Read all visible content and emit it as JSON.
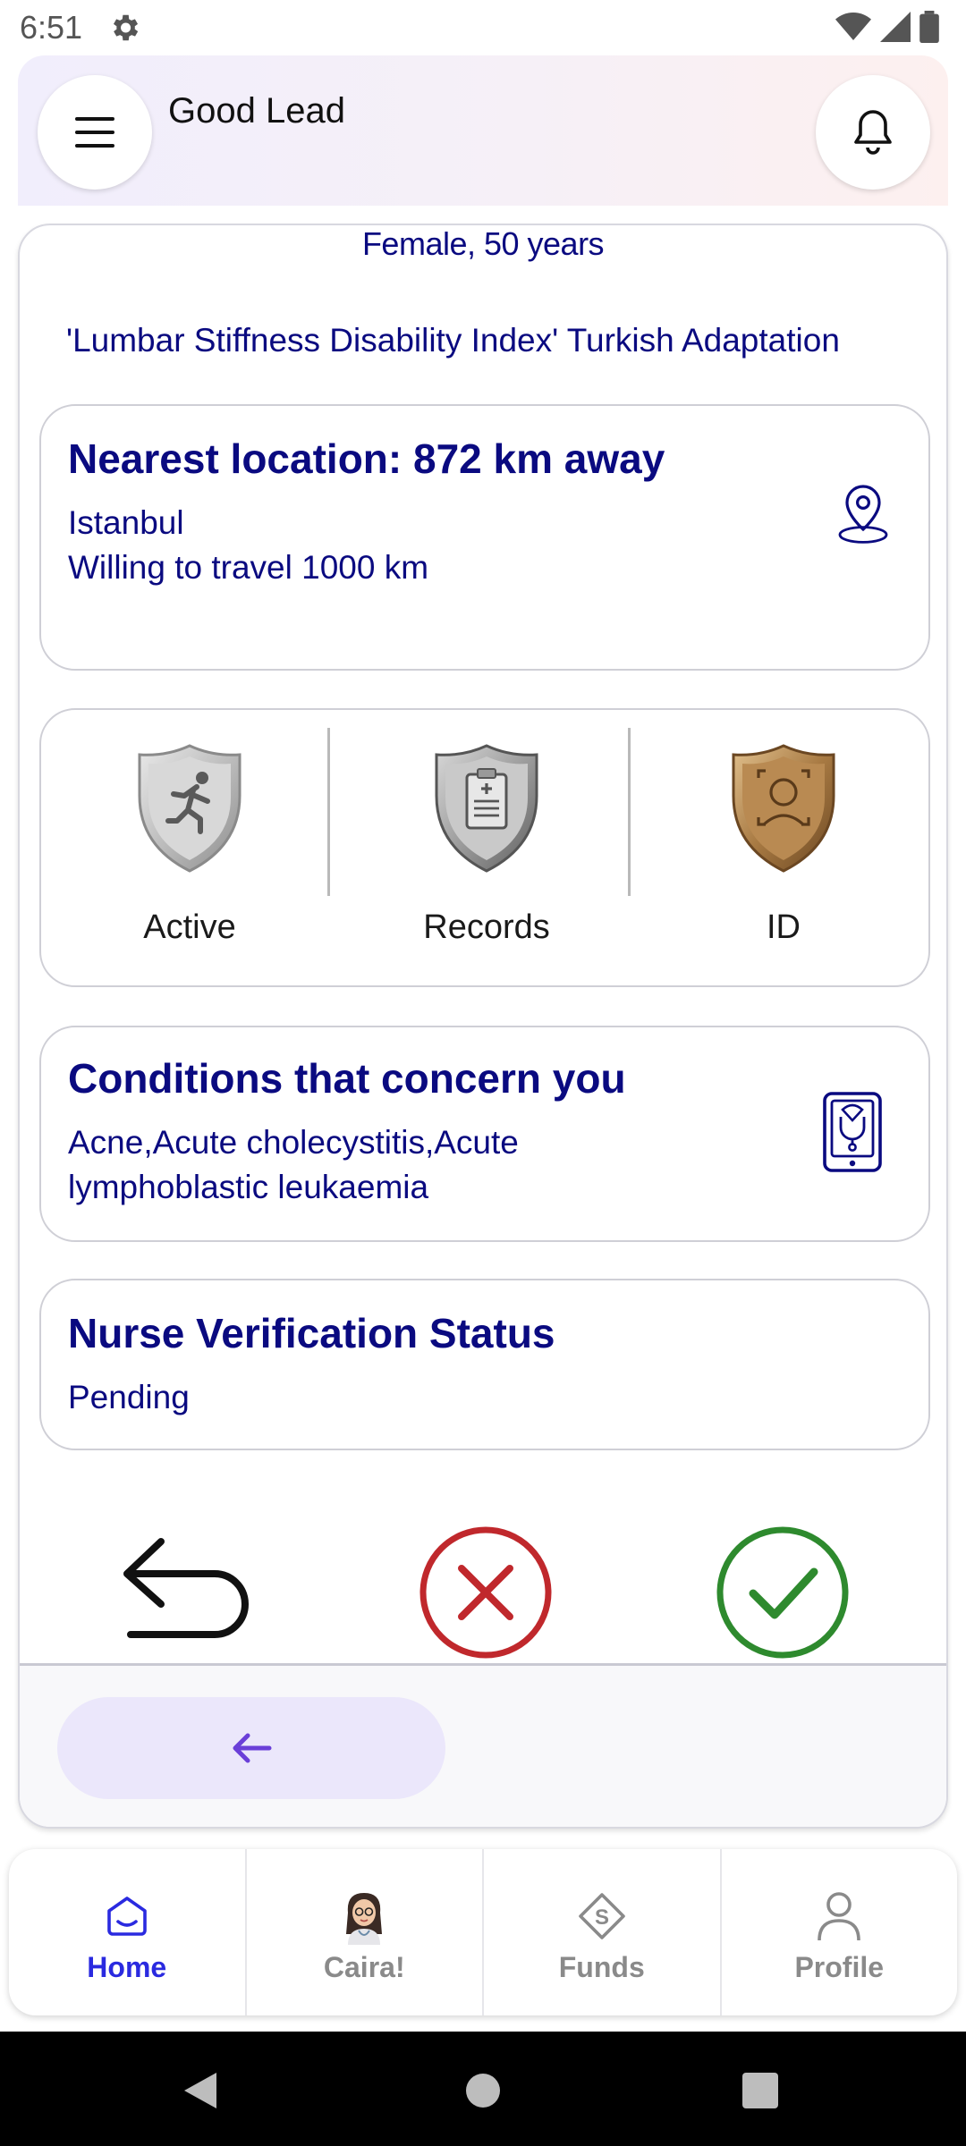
{
  "status_bar": {
    "time": "6:51",
    "icons": [
      "gear-icon",
      "wifi-icon",
      "signal-icon",
      "battery-icon"
    ]
  },
  "header": {
    "title": "Good Lead",
    "menu_icon": "hamburger-menu-icon",
    "bell_icon": "bell-icon"
  },
  "lead": {
    "demographics": "Female, 50 years",
    "study_title": "'Lumbar Stiffness Disability Index' Turkish Adaptation",
    "location": {
      "title": "Nearest location: 872 km away",
      "city": "Istanbul",
      "travel": "Willing to travel 1000 km",
      "icon": "location-pin-icon"
    },
    "badges": [
      {
        "label": "Active",
        "icon": "runner-shield-icon",
        "tone": "silver"
      },
      {
        "label": "Records",
        "icon": "clipboard-shield-icon",
        "tone": "silver"
      },
      {
        "label": "ID",
        "icon": "face-id-shield-icon",
        "tone": "bronze"
      }
    ],
    "conditions": {
      "title": "Conditions that concern you",
      "line1": "Acne,Acute cholecystitis,Acute",
      "line2": "lymphoblastic leukaemia",
      "icon": "phone-stethoscope-icon"
    },
    "verification": {
      "title": "Nurse Verification Status",
      "status": "Pending"
    }
  },
  "actions": {
    "undo_icon": "undo-arrow-icon",
    "reject_icon": "reject-x-icon",
    "accept_icon": "accept-check-icon",
    "back_icon": "back-arrow-icon"
  },
  "bottom_nav": {
    "items": [
      {
        "label": "Home",
        "icon": "home-icon",
        "active": true
      },
      {
        "label": "Caira!",
        "icon": "caira-avatar-icon",
        "active": false
      },
      {
        "label": "Funds",
        "icon": "funds-icon",
        "active": false
      },
      {
        "label": "Profile",
        "icon": "profile-icon",
        "active": false
      }
    ]
  },
  "colors": {
    "primary_text": "#0a0a80",
    "accent": "#2a2ae0",
    "reject": "#c0282c",
    "accept": "#2e8a2e",
    "pill": "#ebe7fb",
    "back_arrow": "#6a3fd8"
  }
}
